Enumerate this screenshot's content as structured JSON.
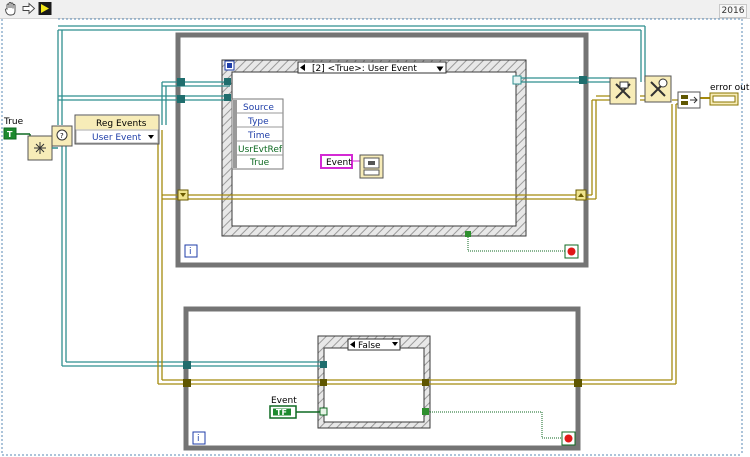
{
  "version": "2016",
  "toolbar": {
    "icons": [
      "hand-tool-icon",
      "arrow-icon",
      "run-icon"
    ]
  },
  "constants": {
    "true_label": "True",
    "true_glyph": "T"
  },
  "register_events": {
    "title": "Reg Events",
    "input": "User Event"
  },
  "event_structure": {
    "case_label": "[2] <True>: User Event",
    "data_items": [
      "Source",
      "Type",
      "Time",
      "UsrEvtRef",
      "True"
    ]
  },
  "event_indicator": {
    "label": "Event"
  },
  "error_out": {
    "label": "error out"
  },
  "case_structure": {
    "selector": "False"
  },
  "event_control": {
    "label": "Event",
    "glyph": "TF"
  },
  "loop_info": "i"
}
